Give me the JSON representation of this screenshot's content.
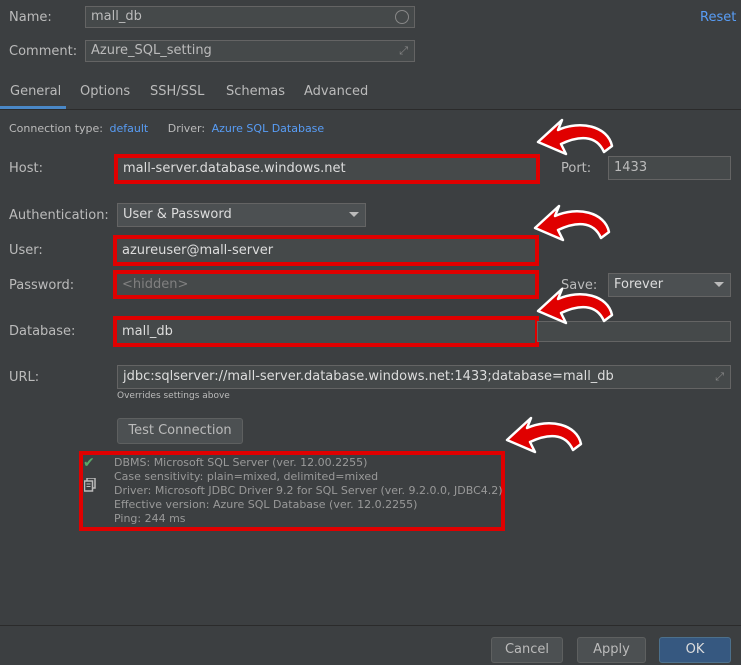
{
  "header": {
    "name_label": "Name:",
    "name_value": "mall_db",
    "comment_label": "Comment:",
    "comment_value": "Azure_SQL_setting",
    "reset_label": "Reset"
  },
  "tabs": [
    {
      "label": "General"
    },
    {
      "label": "Options"
    },
    {
      "label": "SSH/SSL"
    },
    {
      "label": "Schemas"
    },
    {
      "label": "Advanced"
    }
  ],
  "connection": {
    "type_label": "Connection type:",
    "type_value": "default",
    "driver_label": "Driver:",
    "driver_value": "Azure SQL Database"
  },
  "form": {
    "host_label": "Host:",
    "host_value": "mall-server.database.windows.net",
    "port_label": "Port:",
    "port_value": "1433",
    "auth_label": "Authentication:",
    "auth_value": "User & Password",
    "user_label": "User:",
    "user_value": "azureuser@mall-server",
    "password_label": "Password:",
    "password_placeholder": "<hidden>",
    "save_label": "Save:",
    "save_value": "Forever",
    "database_label": "Database:",
    "database_value": "mall_db",
    "url_label": "URL:",
    "url_value": "jdbc:sqlserver://mall-server.database.windows.net:1433;database=mall_db",
    "url_hint": "Overrides settings above",
    "test_button": "Test Connection"
  },
  "test_result": {
    "lines": [
      "DBMS: Microsoft SQL Server (ver. 12.00.2255)",
      "Case sensitivity: plain=mixed, delimited=mixed",
      "Driver: Microsoft JDBC Driver 9.2 for SQL Server (ver. 9.2.0.0, JDBC4.2)",
      "Effective version: Azure SQL Database (ver. 12.0.2255)",
      "Ping: 244 ms"
    ]
  },
  "footer": {
    "cancel": "Cancel",
    "apply": "Apply",
    "ok": "OK"
  },
  "colors": {
    "background": "#3c3f41",
    "link": "#589df6",
    "highlight": "#e00000",
    "success": "#59a869",
    "primary_button": "#365880"
  }
}
